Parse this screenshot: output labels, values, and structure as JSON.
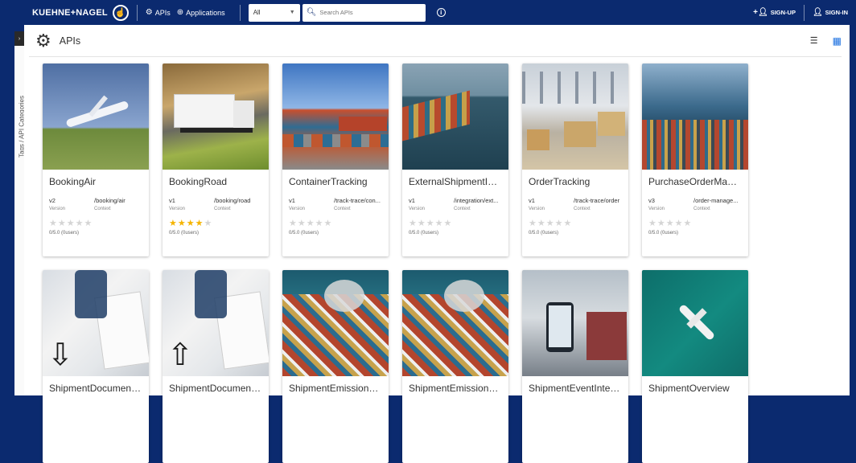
{
  "topbar": {
    "brand": "KUEHNE+NAGEL",
    "nav": [
      {
        "label": "APIs",
        "icon": "gear-icon"
      },
      {
        "label": "Applications",
        "icon": "applications-icon"
      }
    ],
    "filter_value": "All",
    "search_placeholder": "Search APIs",
    "signup_label": "SIGN-UP",
    "signin_label": "SIGN-IN"
  },
  "sidebar": {
    "label": "Tags / API Categories"
  },
  "page": {
    "title": "APIs"
  },
  "cards": [
    {
      "name": "BookingAir",
      "version": "v2",
      "context": "/booking/air",
      "version_label": "Version",
      "context_label": "Context",
      "rating_value": 0,
      "rating_text": "0/5.0 (0users)",
      "image": "sky-plane"
    },
    {
      "name": "BookingRoad",
      "version": "v1",
      "context": "/booking/road",
      "version_label": "Version",
      "context_label": "Context",
      "rating_value": 4,
      "rating_text": "0/5.0 (0users)",
      "image": "road"
    },
    {
      "name": "ContainerTracking",
      "version": "v1",
      "context": "/track-trace/con...",
      "version_label": "Version",
      "context_label": "Context",
      "rating_value": 0,
      "rating_text": "0/5.0 (0users)",
      "image": "yard"
    },
    {
      "name": "ExternalShipmentInte...",
      "version": "v1",
      "context": "/integration/ext...",
      "version_label": "Version",
      "context_label": "Context",
      "rating_value": 0,
      "rating_text": "0/5.0 (0users)",
      "image": "sea"
    },
    {
      "name": "OrderTracking",
      "version": "v1",
      "context": "/track-trace/order",
      "version_label": "Version",
      "context_label": "Context",
      "rating_value": 0,
      "rating_text": "0/5.0 (0users)",
      "image": "warehouse"
    },
    {
      "name": "PurchaseOrderManag...",
      "version": "v3",
      "context": "/order-manage...",
      "version_label": "Version",
      "context_label": "Context",
      "rating_value": 0,
      "rating_text": "0/5.0 (0users)",
      "image": "port"
    },
    {
      "name": "ShipmentDocumentM...",
      "image": "docs",
      "overlay_icon": "cloud-download-icon"
    },
    {
      "name": "ShipmentDocumentM...",
      "image": "docs",
      "overlay_icon": "cloud-upload-icon"
    },
    {
      "name": "ShipmentEmissionTra...",
      "image": "ship"
    },
    {
      "name": "ShipmentEmissionTra...",
      "image": "ship"
    },
    {
      "name": "ShipmentEventIntegra...",
      "image": "phone"
    },
    {
      "name": "ShipmentOverview",
      "image": "aerial"
    }
  ]
}
